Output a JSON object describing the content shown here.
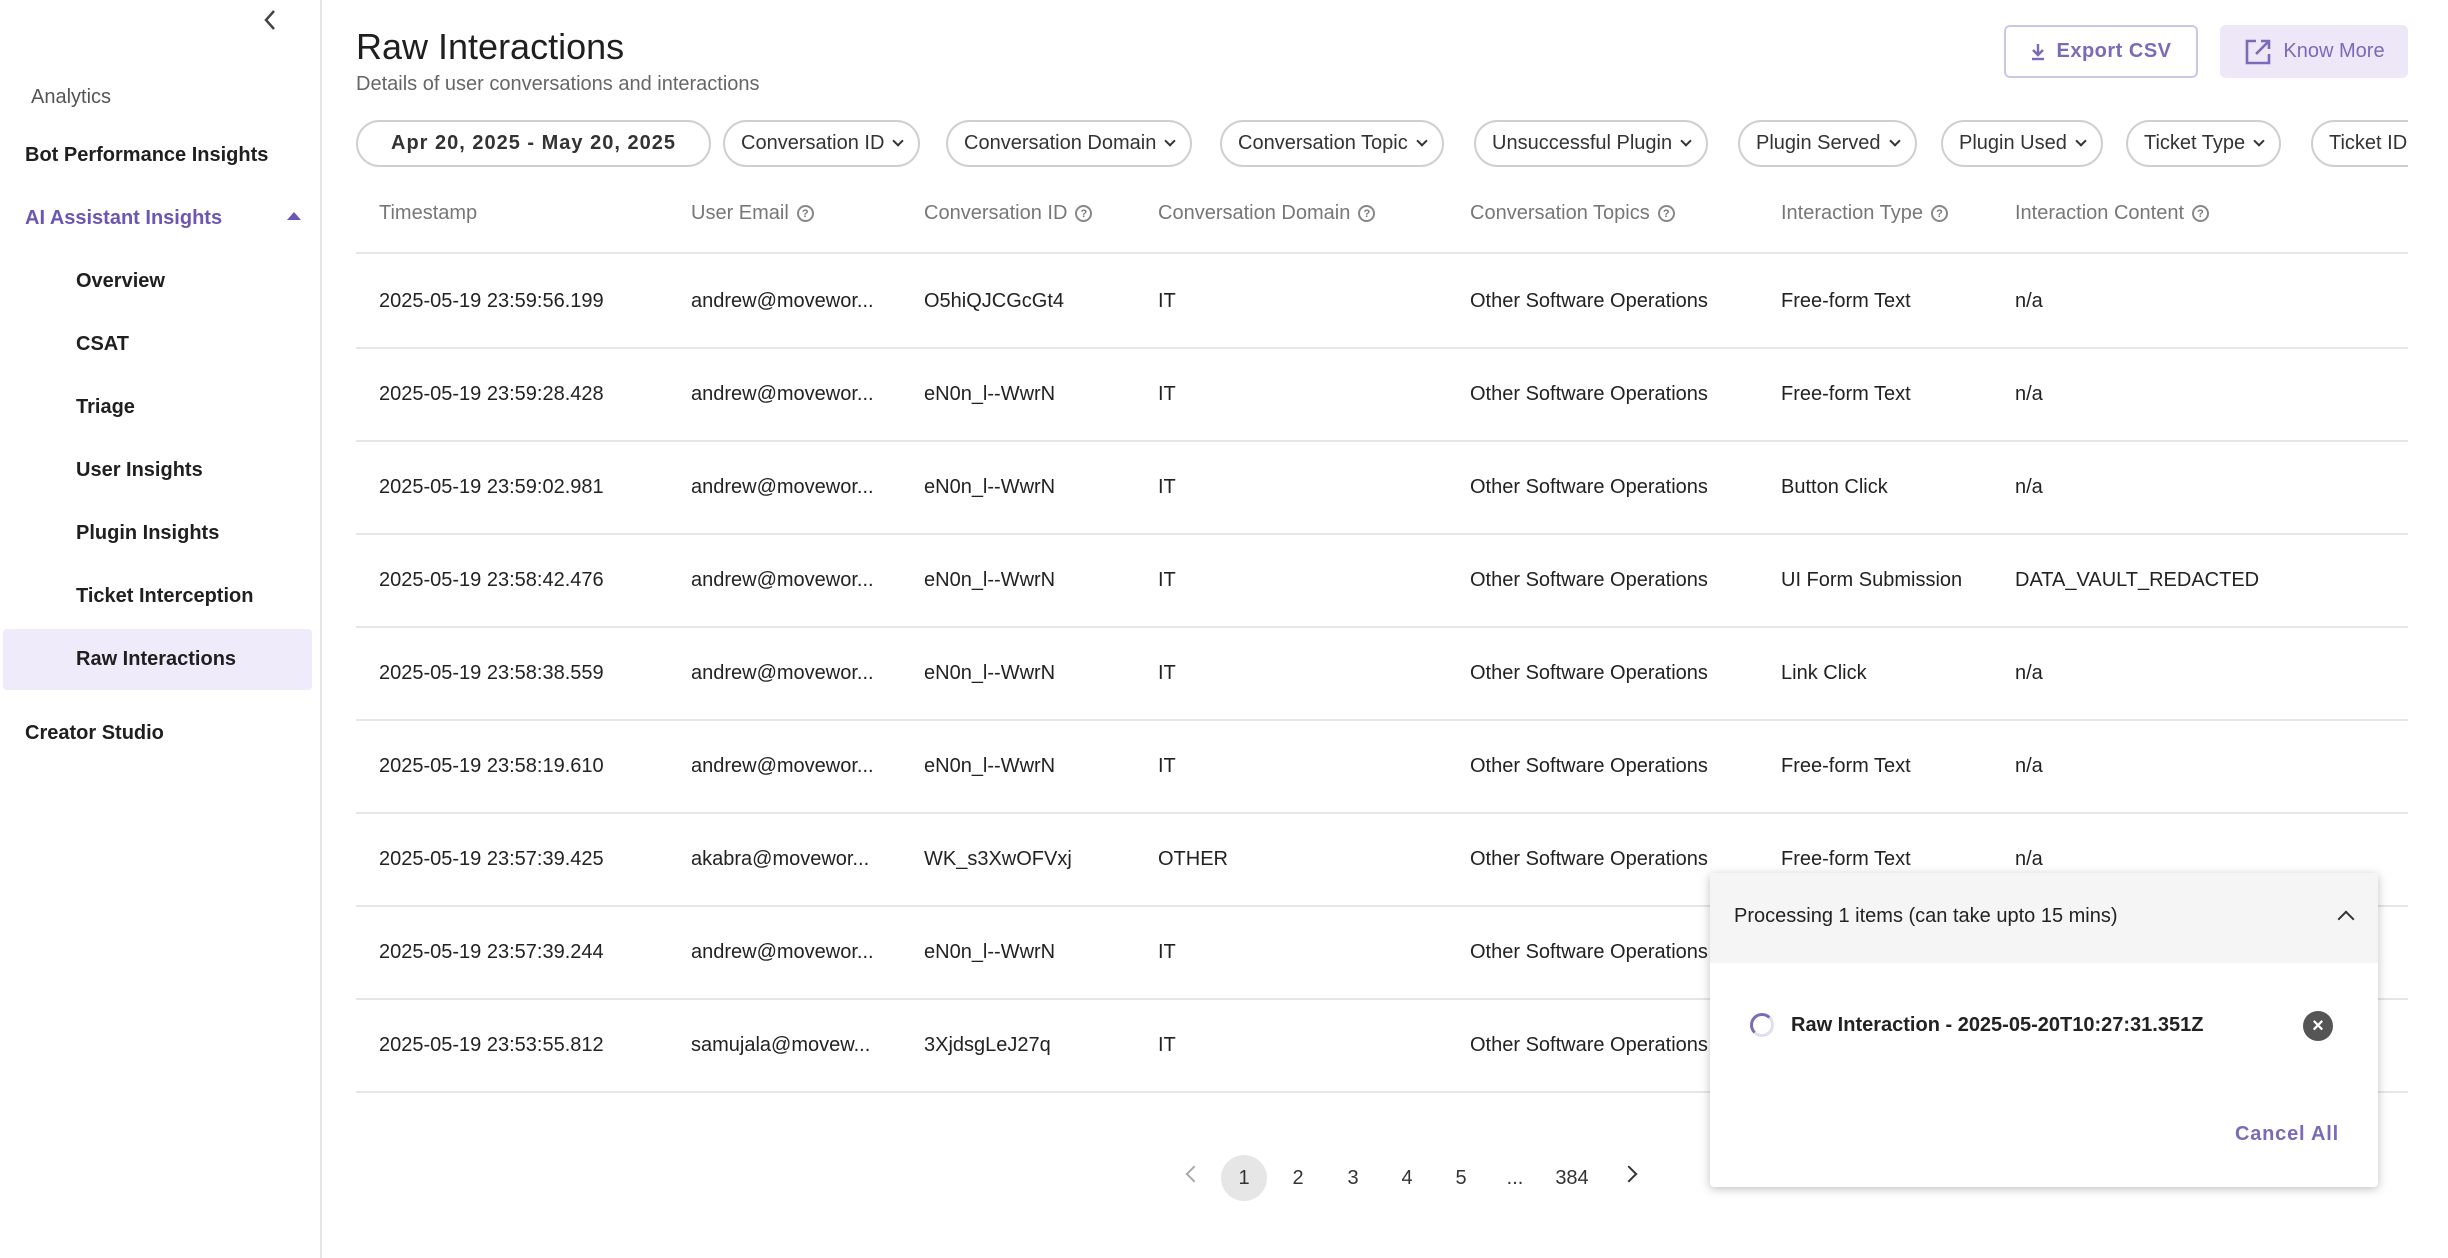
{
  "sidebar": {
    "heading": "Analytics",
    "items": [
      {
        "label": "Bot Performance Insights"
      },
      {
        "label": "AI Assistant Insights"
      },
      {
        "label": "Creator Studio"
      }
    ],
    "subitems": [
      {
        "label": "Overview"
      },
      {
        "label": "CSAT"
      },
      {
        "label": "Triage"
      },
      {
        "label": "User Insights"
      },
      {
        "label": "Plugin Insights"
      },
      {
        "label": "Ticket Interception"
      },
      {
        "label": "Raw Interactions"
      }
    ],
    "active": "Raw Interactions",
    "accent": "#6b55b5"
  },
  "header": {
    "title": "Raw Interactions",
    "subtitle": "Details of user conversations and interactions",
    "export_label": "Export CSV",
    "know_more_label": "Know More"
  },
  "filters": {
    "date_range": "Apr 20, 2025 - May 20, 2025",
    "chips": [
      "Conversation ID",
      "Conversation Domain",
      "Conversation Topic",
      "Unsuccessful Plugin",
      "Plugin Served",
      "Plugin Used",
      "Ticket Type",
      "Ticket ID"
    ]
  },
  "table": {
    "columns": [
      "Timestamp",
      "User Email",
      "Conversation ID",
      "Conversation Domain",
      "Conversation Topics",
      "Interaction Type",
      "Interaction Content"
    ],
    "rows": [
      [
        "2025-05-19 23:59:56.199",
        "andrew@movewor...",
        "O5hiQJCGcGt4",
        "IT",
        "Other Software Operations",
        "Free-form Text",
        "n/a"
      ],
      [
        "2025-05-19 23:59:28.428",
        "andrew@movewor...",
        "eN0n_l--WwrN",
        "IT",
        "Other Software Operations",
        "Free-form Text",
        "n/a"
      ],
      [
        "2025-05-19 23:59:02.981",
        "andrew@movewor...",
        "eN0n_l--WwrN",
        "IT",
        "Other Software Operations",
        "Button Click",
        "n/a"
      ],
      [
        "2025-05-19 23:58:42.476",
        "andrew@movewor...",
        "eN0n_l--WwrN",
        "IT",
        "Other Software Operations",
        "UI Form Submission",
        "DATA_VAULT_REDACTED"
      ],
      [
        "2025-05-19 23:58:38.559",
        "andrew@movewor...",
        "eN0n_l--WwrN",
        "IT",
        "Other Software Operations",
        "Link Click",
        "n/a"
      ],
      [
        "2025-05-19 23:58:19.610",
        "andrew@movewor...",
        "eN0n_l--WwrN",
        "IT",
        "Other Software Operations",
        "Free-form Text",
        "n/a"
      ],
      [
        "2025-05-19 23:57:39.425",
        "akabra@movewor...",
        "WK_s3XwOFVxj",
        "OTHER",
        "Other Software Operations",
        "Free-form Text",
        "n/a"
      ],
      [
        "2025-05-19 23:57:39.244",
        "andrew@movewor...",
        "eN0n_l--WwrN",
        "IT",
        "Other Software Operations",
        "",
        ""
      ],
      [
        "2025-05-19 23:53:55.812",
        "samujala@movew...",
        "3XjdsgLeJ27q",
        "IT",
        "Other Software Operations",
        "",
        ""
      ]
    ]
  },
  "pagination": {
    "pages": [
      "1",
      "2",
      "3",
      "4",
      "5",
      "...",
      "384"
    ],
    "current": "1"
  },
  "processing": {
    "title": "Processing 1 items (can take upto 15 mins)",
    "job_label": "Raw Interaction - 2025-05-20T10:27:31.351Z",
    "cancel_all": "Cancel All"
  }
}
